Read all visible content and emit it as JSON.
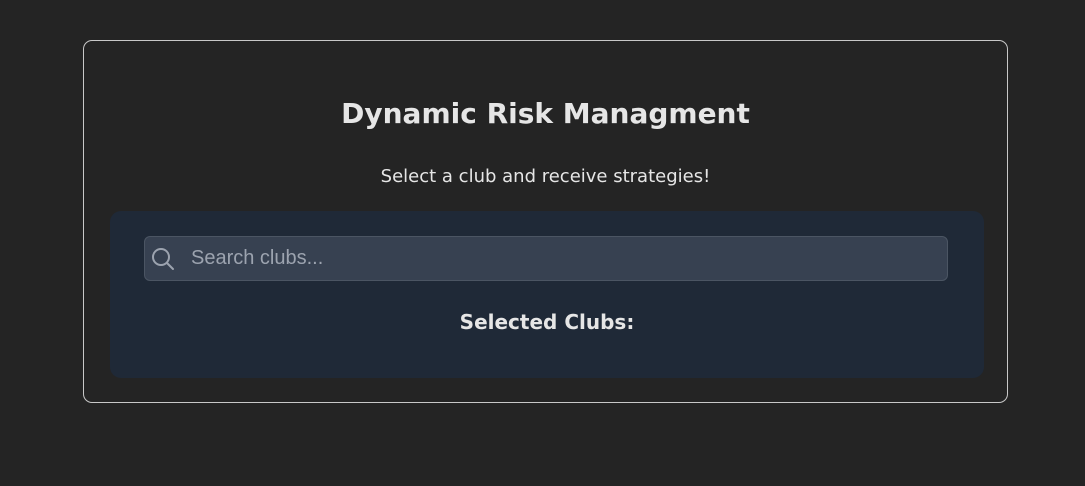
{
  "app": {
    "title": "Dynamic Risk Managment",
    "subtitle": "Select a club and receive strategies!"
  },
  "search": {
    "placeholder": "Search clubs...",
    "value": "",
    "icon": "search-icon"
  },
  "selection": {
    "heading": "Selected Clubs:",
    "items": []
  },
  "colors": {
    "background": "#242424",
    "panel": "#1f2937",
    "input_background": "#374151",
    "text": "#e6e6e6"
  }
}
